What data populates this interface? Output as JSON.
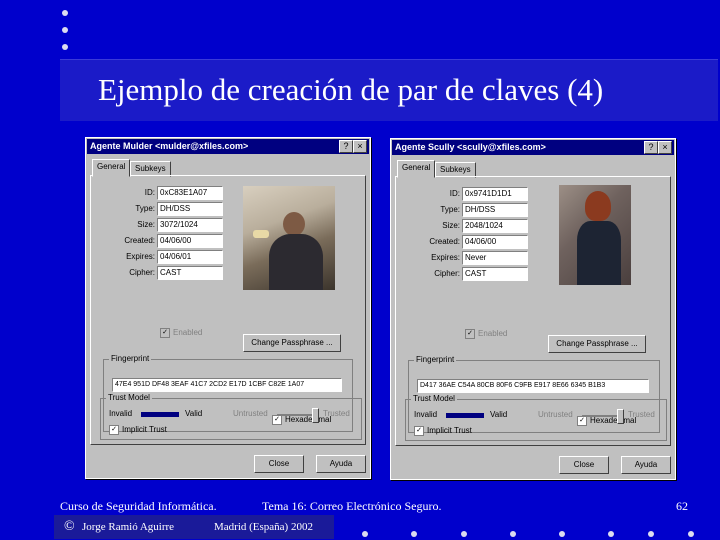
{
  "slide": {
    "title": "Ejemplo de creación de par de claves (4)",
    "page_number": "62"
  },
  "footer": {
    "course": "Curso de Seguridad Informática.",
    "topic": "Tema 16:  Correo Electrónico Seguro.",
    "copyright_symbol": "©",
    "author": "Jorge Ramió Aguirre",
    "place": "Madrid (España) 2002"
  },
  "left_window": {
    "title": "Agente Mulder <mulder@xfiles.com>",
    "help_btn": "?",
    "close_btn": "×",
    "tabs": [
      "General",
      "Subkeys"
    ],
    "fields": [
      {
        "label": "ID:",
        "value": "0xC83E1A07"
      },
      {
        "label": "Type:",
        "value": "DH/DSS"
      },
      {
        "label": "Size:",
        "value": "3072/1024"
      },
      {
        "label": "Created:",
        "value": "04/06/00"
      },
      {
        "label": "Expires:",
        "value": "04/06/01"
      },
      {
        "label": "Cipher:",
        "value": "CAST"
      }
    ],
    "enabled_label": "Enabled",
    "change_passphrase": "Change Passphrase ...",
    "fingerprint_label": "Fingerprint",
    "fingerprint": "47E4 951D DF48 3EAF 41C7  2CD2 E17D 1CBF C82E 1A07",
    "hexadecimal_label": "Hexadecimal",
    "trust_model_label": "Trust Model",
    "validity": {
      "invalid": "Invalid",
      "valid": "Valid",
      "level": 1.0
    },
    "trust": {
      "untrusted": "Untrusted",
      "trusted": "Trusted",
      "level": 1.0
    },
    "implicit_trust_label": "Implicit Trust",
    "close_button": "Close",
    "help_button": "Ayuda"
  },
  "right_window": {
    "title": "Agente Scully <scully@xfiles.com>",
    "help_btn": "?",
    "close_btn": "×",
    "tabs": [
      "General",
      "Subkeys"
    ],
    "fields": [
      {
        "label": "ID:",
        "value": "0x9741D1D1"
      },
      {
        "label": "Type:",
        "value": "DH/DSS"
      },
      {
        "label": "Size:",
        "value": "2048/1024"
      },
      {
        "label": "Created:",
        "value": "04/06/00"
      },
      {
        "label": "Expires:",
        "value": "Never"
      },
      {
        "label": "Cipher:",
        "value": "CAST"
      }
    ],
    "enabled_label": "Enabled",
    "change_passphrase": "Change Passphrase ...",
    "fingerprint_label": "Fingerprint",
    "fingerprint": "D417 36AE C54A 80CB 80F6  C9FB E917 8E66 6345 B1B3",
    "hexadecimal_label": "Hexadecimal",
    "trust_model_label": "Trust Model",
    "validity": {
      "invalid": "Invalid",
      "valid": "Valid",
      "level": 1.0
    },
    "trust": {
      "untrusted": "Untrusted",
      "trusted": "Trusted",
      "level": 1.0
    },
    "implicit_trust_label": "Implicit Trust",
    "close_button": "Close",
    "help_button": "Ayuda"
  }
}
